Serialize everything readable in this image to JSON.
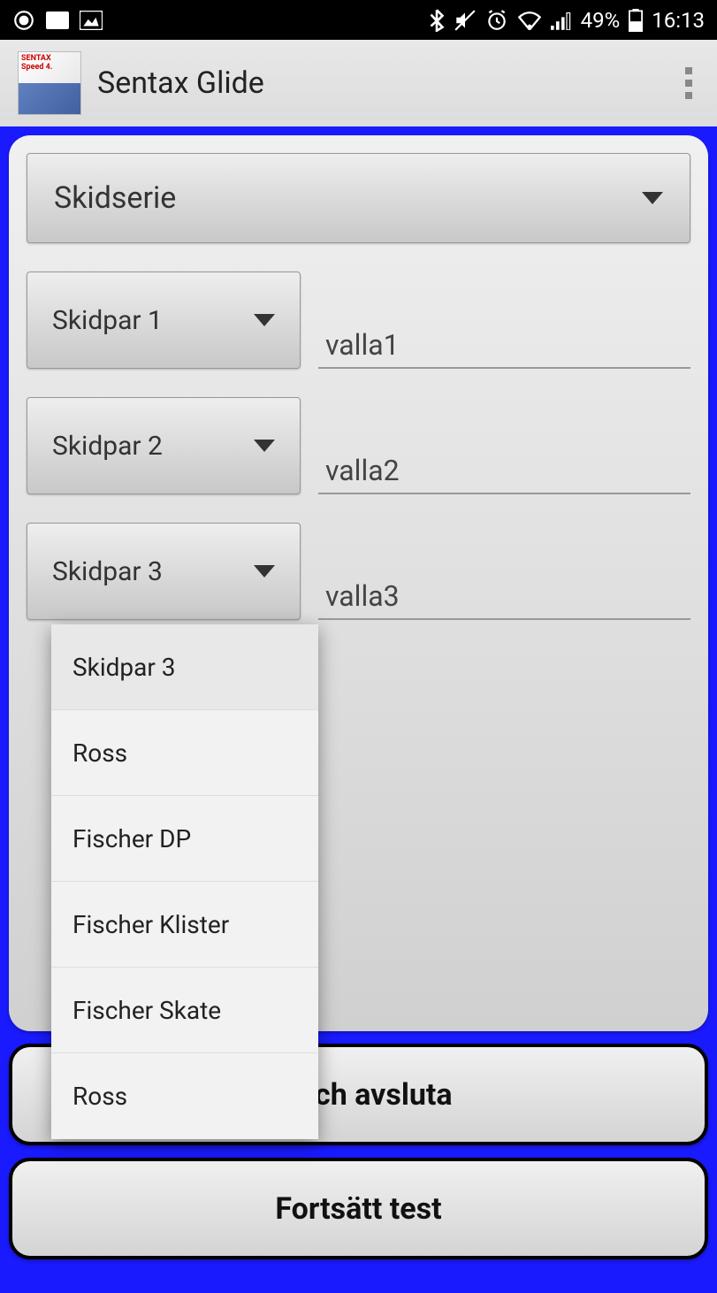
{
  "status": {
    "battery": "49%",
    "time": "16:13"
  },
  "appbar": {
    "title": "Sentax Glide"
  },
  "main": {
    "series_spinner": "Skidserie",
    "rows": [
      {
        "spinner": "Skidpar 1",
        "value": "valla1"
      },
      {
        "spinner": "Skidpar 2",
        "value": "valla2"
      },
      {
        "spinner": "Skidpar 3",
        "value": "valla3"
      }
    ]
  },
  "dropdown": {
    "items": [
      "Skidpar 3",
      "Ross",
      "Fischer DP",
      "Fischer Klister",
      "Fischer Skate",
      "Ross"
    ]
  },
  "buttons": {
    "save_exit_partial": "st och avsluta",
    "continue": "Fortsätt test"
  }
}
